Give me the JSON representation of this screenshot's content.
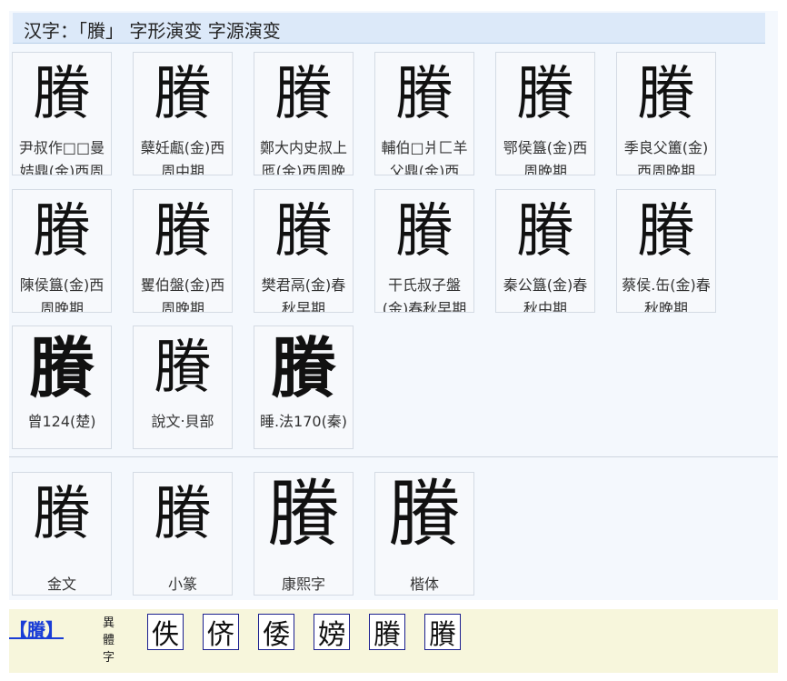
{
  "header": {
    "title": "汉字：「賸」 字形演变 字源演变"
  },
  "row1": [
    {
      "glyph": "賸",
      "caption": "尹叔作□□曼姞鼎(金)西周"
    },
    {
      "glyph": "賸",
      "caption": "蘖妊甗(金)西周中期"
    },
    {
      "glyph": "賸",
      "caption": "鄭大内史叔上匜(金)西周晚"
    },
    {
      "glyph": "賸",
      "caption": "輔伯□爿匚羊父鼎(金)西"
    },
    {
      "glyph": "賸",
      "caption": "鄂侯簋(金)西周晚期"
    },
    {
      "glyph": "賸",
      "caption": "季良父簠(金)西周晚期"
    }
  ],
  "row2": [
    {
      "glyph": "賸",
      "caption": "陳侯簋(金)西周晚期"
    },
    {
      "glyph": "賸",
      "caption": "矍伯盤(金)西周晚期"
    },
    {
      "glyph": "賸",
      "caption": "樊君鬲(金)春秋早期"
    },
    {
      "glyph": "賸",
      "caption": "干氏叔子盤(金)春秋早期"
    },
    {
      "glyph": "賸",
      "caption": "秦公簋(金)春秋中期"
    },
    {
      "glyph": "賸",
      "caption": "蔡侯.缶(金)春秋晚期"
    }
  ],
  "row3": [
    {
      "glyph": "賸",
      "caption": "曾124(楚)"
    },
    {
      "glyph": "賸",
      "caption": "說文‧貝部"
    },
    {
      "glyph": "賸",
      "caption": "睡.法170(秦)"
    }
  ],
  "forms": [
    {
      "glyph": "賸",
      "caption": "金文"
    },
    {
      "glyph": "賸",
      "caption": "小篆"
    },
    {
      "glyph": "賸",
      "caption": "康熙字"
    },
    {
      "glyph": "賸",
      "caption": "楷体"
    }
  ],
  "variants": {
    "link": "【賸】",
    "label": "異體字",
    "chars": [
      "佚",
      "侪",
      "倭",
      "嫎",
      "賸",
      "賸"
    ]
  },
  "colors": {
    "header_bg": "#dce9f9",
    "link": "#1a3dd6",
    "variant_bg": "#f7f6dc",
    "variant_border": "#1b1f8f"
  }
}
